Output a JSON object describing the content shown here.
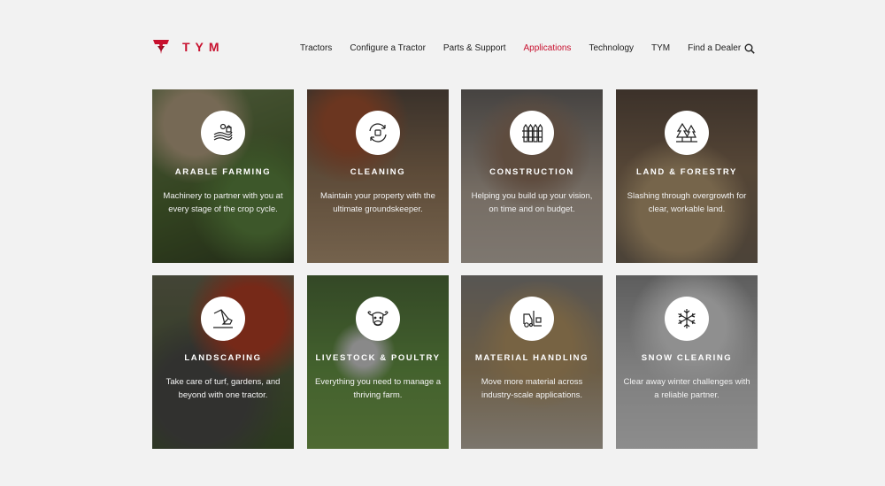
{
  "brand": {
    "name": "TYM",
    "accent_color": "#c8102e"
  },
  "nav": {
    "items": [
      {
        "label": "Tractors",
        "active": false
      },
      {
        "label": "Configure a Tractor",
        "active": false
      },
      {
        "label": "Parts & Support",
        "active": false
      },
      {
        "label": "Applications",
        "active": true
      },
      {
        "label": "Technology",
        "active": false
      },
      {
        "label": "TYM",
        "active": false
      },
      {
        "label": "Find a Dealer",
        "active": false
      }
    ],
    "search_icon": "search-icon"
  },
  "cards": [
    {
      "title": "ARABLE FARMING",
      "description": "Machinery to partner with you at every stage of the crop cycle.",
      "icon": "farm-field-icon"
    },
    {
      "title": "CLEANING",
      "description": "Maintain your property with the ultimate groundskeeper.",
      "icon": "broom-cycle-icon"
    },
    {
      "title": "CONSTRUCTION",
      "description": "Helping you build up your vision, on time and on budget.",
      "icon": "fence-icon"
    },
    {
      "title": "LAND & FORESTRY",
      "description": "Slashing through overgrowth for clear, workable land.",
      "icon": "trees-icon"
    },
    {
      "title": "LANDSCAPING",
      "description": "Take care of turf, gardens, and beyond with one tractor.",
      "icon": "excavator-arm-icon"
    },
    {
      "title": "LIVESTOCK & POULTRY",
      "description": "Everything you need to manage a thriving farm.",
      "icon": "cow-icon"
    },
    {
      "title": "MATERIAL HANDLING",
      "description": "Move more material across industry-scale applications.",
      "icon": "forklift-icon"
    },
    {
      "title": "SNOW CLEARING",
      "description": "Clear away winter challenges with a reliable partner.",
      "icon": "snowflake-icon"
    }
  ]
}
